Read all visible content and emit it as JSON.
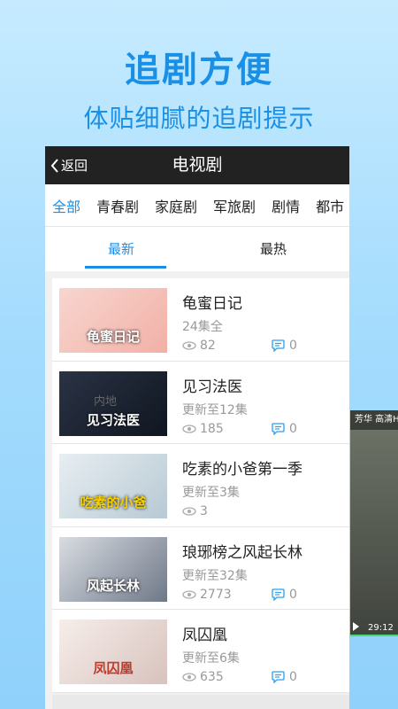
{
  "promo": {
    "headline": "追剧方便",
    "subline": "体贴细腻的追剧提示"
  },
  "side_peek": {
    "text": "芳华 高清H",
    "duration": "29:12"
  },
  "titlebar": {
    "back_label": "返回",
    "title": "电视剧"
  },
  "category_tabs": [
    "全部",
    "青春剧",
    "家庭剧",
    "军旅剧",
    "剧情",
    "都市"
  ],
  "sort_tabs": [
    "最新",
    "最热"
  ],
  "items": [
    {
      "title": "龟蜜日记",
      "status": "24集全",
      "views": "82",
      "comments": "0",
      "poster_caption": "龟蜜日记",
      "poster_colors": [
        "#f7d6cf",
        "#f2b0a6"
      ]
    },
    {
      "title": "见习法医",
      "status": "更新至12集",
      "views": "185",
      "comments": "0",
      "poster_caption": "见习法医",
      "poster_colors": [
        "#2a3345",
        "#101620"
      ]
    },
    {
      "title": "吃素的小爸第一季",
      "status": "更新至3集",
      "views": "3",
      "comments": "",
      "poster_caption": "吃素的小爸",
      "poster_colors": [
        "#e8eef2",
        "#b7c9d3"
      ]
    },
    {
      "title": "琅琊榜之风起长林",
      "status": "更新至32集",
      "views": "2773",
      "comments": "0",
      "poster_caption": "风起长林",
      "poster_colors": [
        "#d9dde2",
        "#6f7888"
      ]
    },
    {
      "title": "凤囚凰",
      "status": "更新至6集",
      "views": "635",
      "comments": "0",
      "poster_caption": "凤囚凰",
      "poster_colors": [
        "#f6eeea",
        "#d8c2bd"
      ]
    }
  ],
  "overlay_label": "内地",
  "colors": {
    "accent": "#1b8de6",
    "titlebar": "#222222"
  }
}
